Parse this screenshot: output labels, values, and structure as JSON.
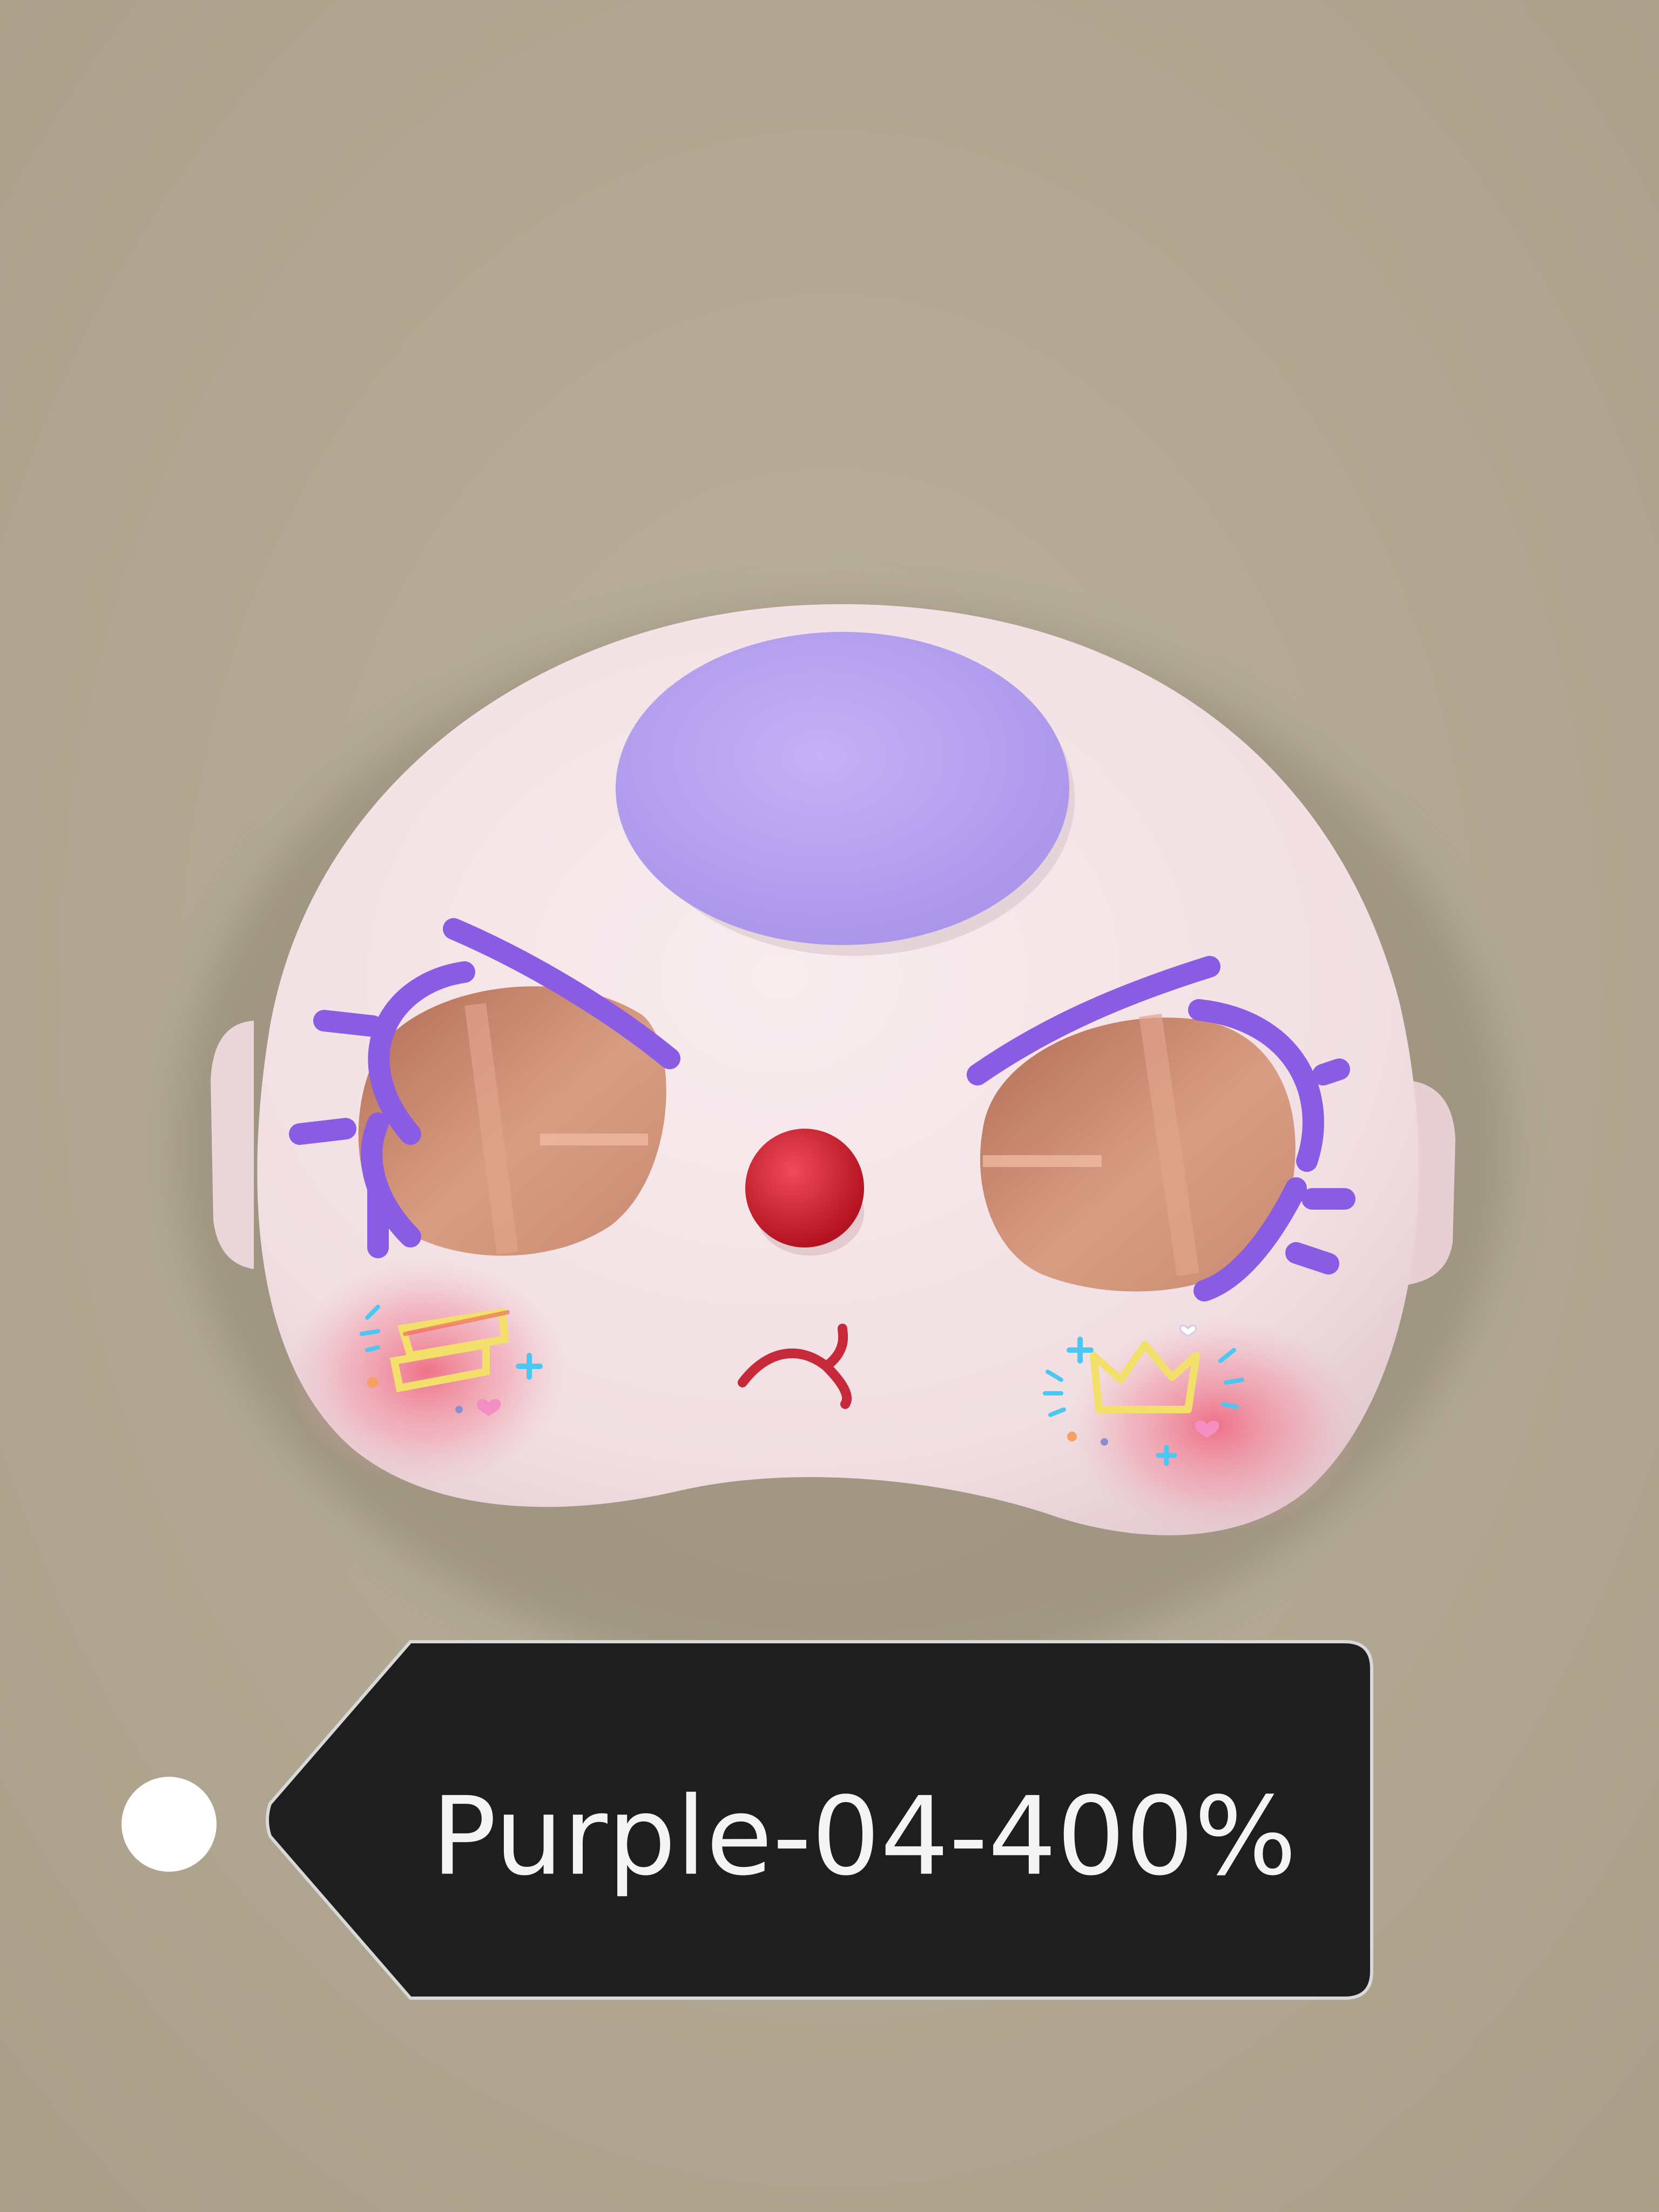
{
  "photo": {
    "subject": "mask",
    "background_color": "#b5ab97",
    "mask_color": "#f3e2e6",
    "top_dome_color": "#b9a4f2",
    "brow_lash_color": "#8a5be3",
    "nose_color": "#d51f36",
    "mouth_color": "#c62a3a",
    "blush_color": "#f06f86",
    "eye_interior_color": "#c9876f",
    "sticker_yellow": "#f3e06a",
    "sticker_blue": "#4cc7f4",
    "sticker_pink": "#f38fc2"
  },
  "tag": {
    "label": "Purple-04-400%",
    "background_color": "#1e1e1e",
    "text_color": "#f4f4f4"
  },
  "marker": {
    "color": "#ffffff"
  }
}
